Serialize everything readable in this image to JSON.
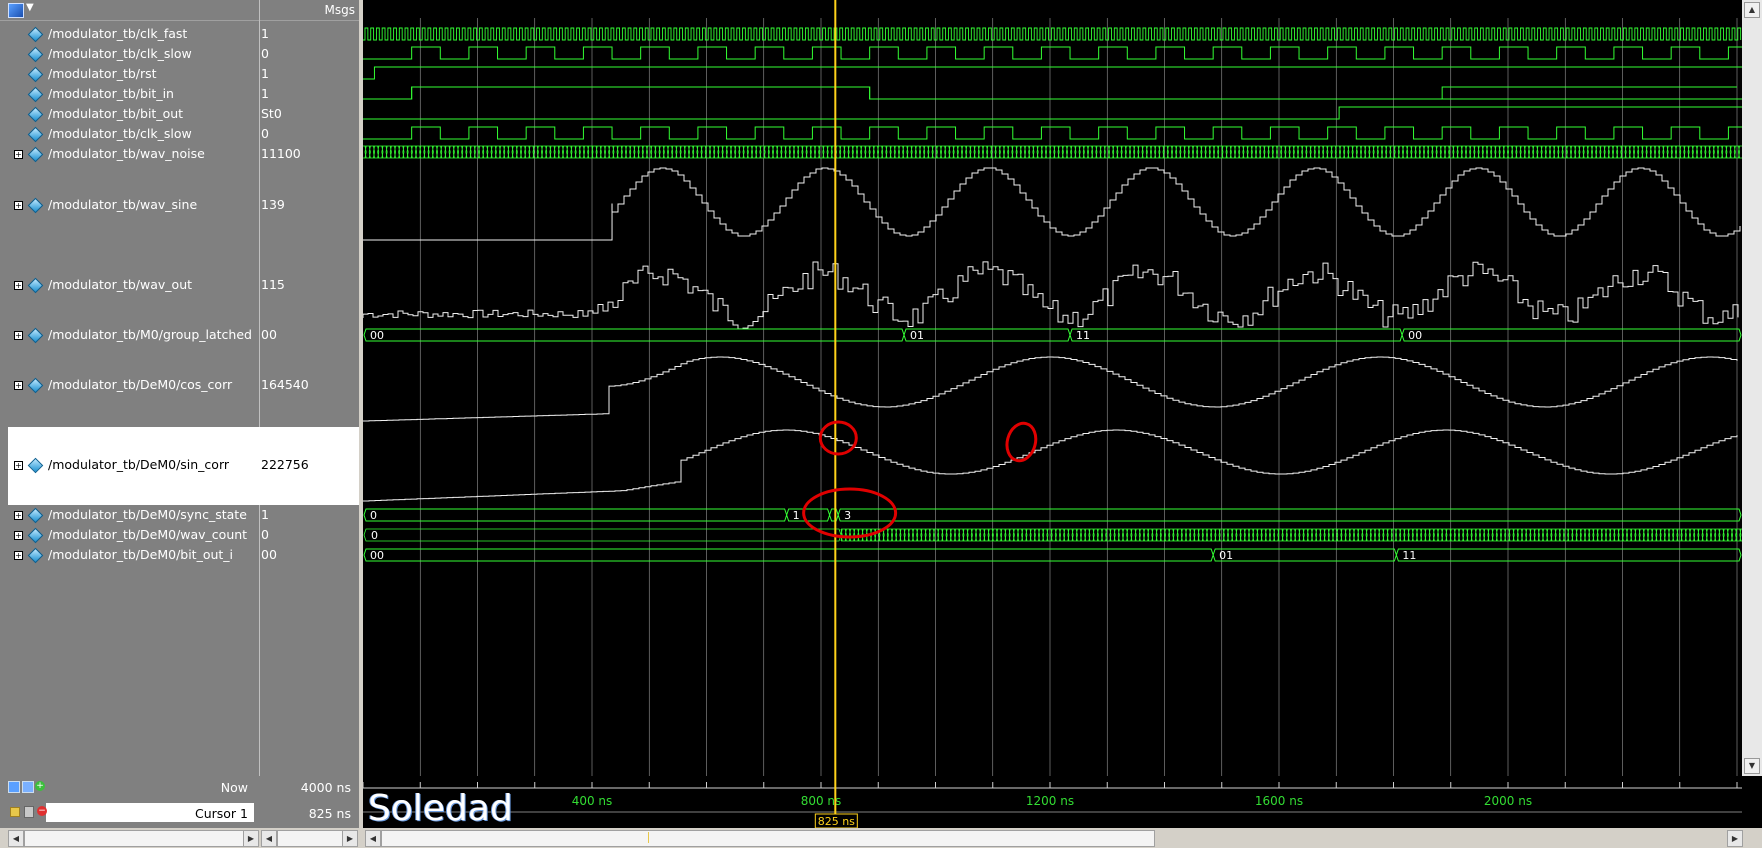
{
  "header": {
    "msgs_label": "Msgs"
  },
  "signals": [
    {
      "name": "/modulator_tb/clk_fast",
      "value": "1",
      "expandable": false
    },
    {
      "name": "/modulator_tb/clk_slow",
      "value": "0",
      "expandable": false
    },
    {
      "name": "/modulator_tb/rst",
      "value": "1",
      "expandable": false
    },
    {
      "name": "/modulator_tb/bit_in",
      "value": "1",
      "expandable": false
    },
    {
      "name": "/modulator_tb/bit_out",
      "value": "St0",
      "expandable": false
    },
    {
      "name": "/modulator_tb/clk_slow",
      "value": "0",
      "expandable": false
    },
    {
      "name": "/modulator_tb/wav_noise",
      "value": "11100",
      "expandable": true
    },
    {
      "name": "/modulator_tb/wav_sine",
      "value": "139",
      "expandable": true
    },
    {
      "name": "/modulator_tb/wav_out",
      "value": "115",
      "expandable": true
    },
    {
      "name": "/modulator_tb/M0/group_latched",
      "value": "00",
      "expandable": true
    },
    {
      "name": "/modulator_tb/DeM0/cos_corr",
      "value": "164540",
      "expandable": true
    },
    {
      "name": "/modulator_tb/DeM0/sin_corr",
      "value": "222756",
      "expandable": true,
      "selected": true
    },
    {
      "name": "/modulator_tb/DeM0/sync_state",
      "value": "1",
      "expandable": true
    },
    {
      "name": "/modulator_tb/DeM0/wav_count",
      "value": "0",
      "expandable": true
    },
    {
      "name": "/modulator_tb/DeM0/bit_out_i",
      "value": "00",
      "expandable": true
    }
  ],
  "bus_labels": {
    "group_latched": [
      "00",
      "01",
      "11",
      "00"
    ],
    "sync_state": [
      "0",
      "1",
      "3"
    ],
    "wav_count": [
      "0"
    ],
    "bit_out_i": [
      "00",
      "01",
      "11"
    ]
  },
  "footer": {
    "now_label": "Now",
    "now_value": "4000 ns",
    "cursor_label": "Cursor 1",
    "cursor_value": "825 ns"
  },
  "timeline": {
    "ticks": [
      "400 ns",
      "800 ns",
      "1200 ns",
      "1600 ns",
      "2000 ns"
    ],
    "cursor_tag": "825 ns"
  },
  "watermark": "Soledad",
  "colors": {
    "wave": "#33ff33",
    "cursor": "#ffd21a",
    "annotation": "#e00000",
    "panel": "#808080"
  }
}
